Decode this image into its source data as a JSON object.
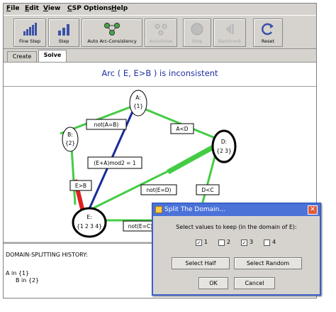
{
  "menu": [
    {
      "label": "File",
      "underline": "F",
      "rest": "ile"
    },
    {
      "label": "Edit",
      "underline": "E",
      "rest": "dit"
    },
    {
      "label": "View",
      "underline": "V",
      "rest": "iew"
    },
    {
      "label": "CSP Options",
      "underline": "C",
      "rest": "SP Options"
    },
    {
      "label": "Help",
      "underline": "H",
      "rest": "elp"
    }
  ],
  "toolbar": {
    "fine_step": "Fine Step",
    "step": "Step",
    "auto_arc": "Auto Arc-Consistency",
    "auto_solve": "AutoSolve",
    "stop": "Stop",
    "backtrack": "Backtrack",
    "reset": "Reset"
  },
  "tabs": {
    "create": "Create",
    "solve": "Solve"
  },
  "status": "Arc ( E, E>B ) is inconsistent",
  "graph": {
    "nodes": {
      "A": {
        "name": "A:",
        "domain": "{1}"
      },
      "B": {
        "name": "B:",
        "domain": "{2}"
      },
      "D": {
        "name": "D:",
        "domain": "{2 3}"
      },
      "E": {
        "name": "E:",
        "domain": "{1 2 3 4}"
      }
    },
    "constraints": {
      "not_a_b": "not(A=B)",
      "a_lt_d": "A<D",
      "e_a_mod": "(E+A)mod2 = 1",
      "e_gt_b": "E>B",
      "not_e_d": "not(E=D)",
      "d_lt_c": "D<C",
      "not_e_c": "not(E=C)"
    }
  },
  "history": {
    "title": "DOMAIN-SPLITTING HISTORY:",
    "lines": [
      "A in {1}",
      "B in {2}"
    ]
  },
  "dialog": {
    "title": "Split The Domain...",
    "prompt": "Select values to keep (in the domain of E):",
    "options": [
      {
        "label": "1",
        "checked": true
      },
      {
        "label": "2",
        "checked": false
      },
      {
        "label": "3",
        "checked": true
      },
      {
        "label": "4",
        "checked": false
      }
    ],
    "select_half": "Select Half",
    "select_random": "Select Random",
    "ok": "OK",
    "cancel": "Cancel"
  },
  "colors": {
    "status_text": "#2030a0",
    "arc_green": "#44cc44",
    "arc_blue": "#1a2a9a",
    "arc_red": "#dd2020",
    "title_bar": "#4a72d8"
  }
}
